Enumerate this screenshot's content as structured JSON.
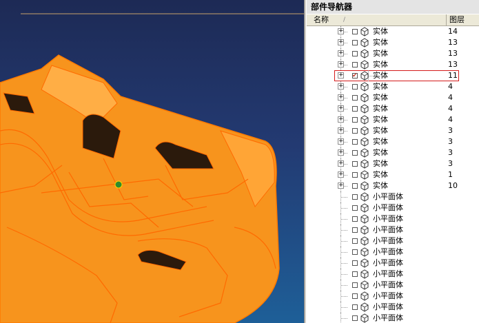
{
  "navigator": {
    "title": "部件导航器",
    "columns": {
      "name": "名称",
      "sort_glyph": "/",
      "layer": "图层"
    },
    "rows": [
      {
        "label": "实体",
        "layer": "14",
        "expandable": true,
        "checked": false,
        "selected": false
      },
      {
        "label": "实体",
        "layer": "13",
        "expandable": true,
        "checked": false,
        "selected": false
      },
      {
        "label": "实体",
        "layer": "13",
        "expandable": true,
        "checked": false,
        "selected": false
      },
      {
        "label": "实体",
        "layer": "13",
        "expandable": true,
        "checked": false,
        "selected": false
      },
      {
        "label": "实体",
        "layer": "11",
        "expandable": true,
        "checked": true,
        "selected": true
      },
      {
        "label": "实体",
        "layer": "4",
        "expandable": true,
        "checked": false,
        "selected": false
      },
      {
        "label": "实体",
        "layer": "4",
        "expandable": true,
        "checked": false,
        "selected": false
      },
      {
        "label": "实体",
        "layer": "4",
        "expandable": true,
        "checked": false,
        "selected": false
      },
      {
        "label": "实体",
        "layer": "4",
        "expandable": true,
        "checked": false,
        "selected": false
      },
      {
        "label": "实体",
        "layer": "3",
        "expandable": true,
        "checked": false,
        "selected": false
      },
      {
        "label": "实体",
        "layer": "3",
        "expandable": true,
        "checked": false,
        "selected": false
      },
      {
        "label": "实体",
        "layer": "3",
        "expandable": true,
        "checked": false,
        "selected": false
      },
      {
        "label": "实体",
        "layer": "3",
        "expandable": true,
        "checked": false,
        "selected": false
      },
      {
        "label": "实体",
        "layer": "1",
        "expandable": true,
        "checked": false,
        "selected": false
      },
      {
        "label": "实体",
        "layer": "10",
        "expandable": true,
        "checked": false,
        "selected": false
      },
      {
        "label": "小平面体",
        "layer": "",
        "expandable": false,
        "checked": false,
        "selected": false
      },
      {
        "label": "小平面体",
        "layer": "",
        "expandable": false,
        "checked": false,
        "selected": false
      },
      {
        "label": "小平面体",
        "layer": "",
        "expandable": false,
        "checked": false,
        "selected": false
      },
      {
        "label": "小平面体",
        "layer": "",
        "expandable": false,
        "checked": false,
        "selected": false
      },
      {
        "label": "小平面体",
        "layer": "",
        "expandable": false,
        "checked": false,
        "selected": false
      },
      {
        "label": "小平面体",
        "layer": "",
        "expandable": false,
        "checked": false,
        "selected": false
      },
      {
        "label": "小平面体",
        "layer": "",
        "expandable": false,
        "checked": false,
        "selected": false
      },
      {
        "label": "小平面体",
        "layer": "",
        "expandable": false,
        "checked": false,
        "selected": false
      },
      {
        "label": "小平面体",
        "layer": "",
        "expandable": false,
        "checked": false,
        "selected": false
      },
      {
        "label": "小平面体",
        "layer": "",
        "expandable": false,
        "checked": false,
        "selected": false
      },
      {
        "label": "小平面体",
        "layer": "",
        "expandable": false,
        "checked": false,
        "selected": false
      },
      {
        "label": "小平面体",
        "layer": "",
        "expandable": false,
        "checked": false,
        "selected": false
      }
    ]
  },
  "colors": {
    "viewport_top": "#1d2a55",
    "viewport_bottom": "#1e5f98",
    "model_fill": "#f7941d",
    "model_edge": "#ff6a00",
    "selection_outline": "#d41a1a"
  }
}
